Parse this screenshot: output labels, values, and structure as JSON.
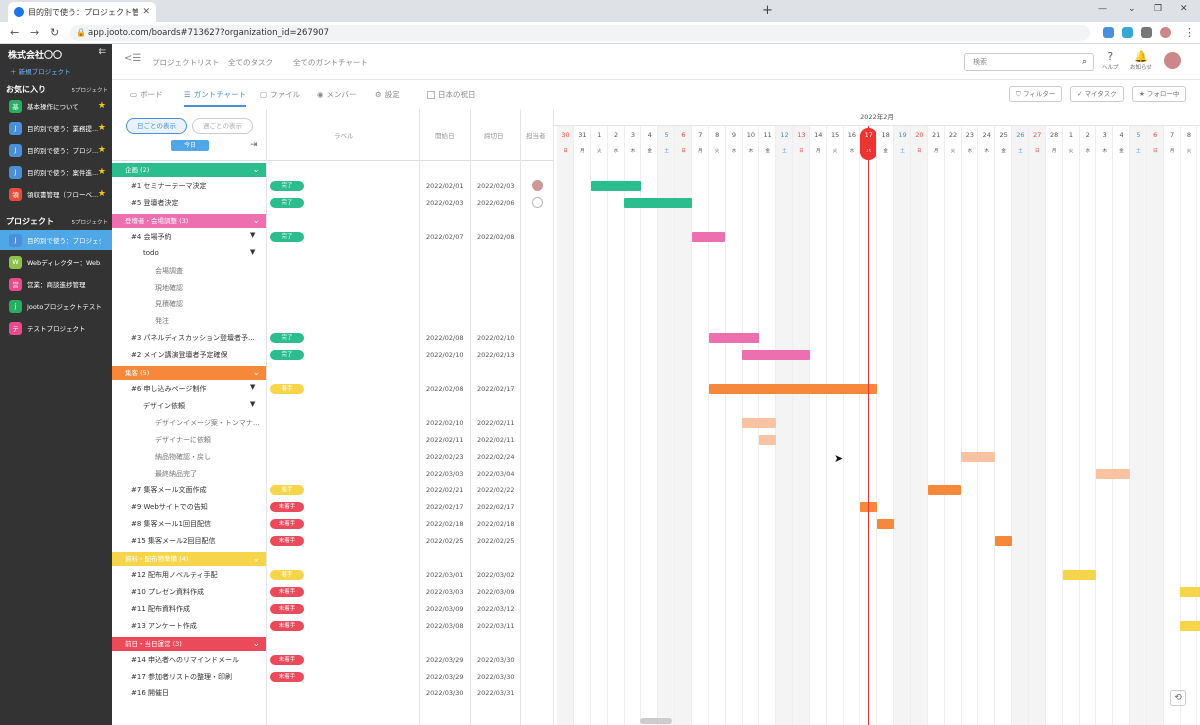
{
  "browser": {
    "tab_title": "目的別で使う：プロジェクト管理 - Jo",
    "url": "app.jooto.com/boards#713627?organization_id=267907"
  },
  "sidebar": {
    "org": "株式会社〇〇",
    "new_project": "新規プロジェクト",
    "fav_title": "お気に入り",
    "fav_count": "5プロジェクト",
    "favorites": [
      {
        "icon": "基",
        "label": "基本操作について",
        "color": "#27ae60"
      },
      {
        "icon": "J",
        "label": "目的別で使う：業務提...",
        "color": "#4a90d9"
      },
      {
        "icon": "J",
        "label": "目的別で使う：プロジ...",
        "color": "#4a90d9"
      },
      {
        "icon": "J",
        "label": "目的別で使う：案件進...",
        "color": "#4a90d9"
      },
      {
        "icon": "領",
        "label": "領収書管理（フローベ...",
        "color": "#e74c3c"
      }
    ],
    "proj_title": "プロジェクト",
    "proj_count": "5プロジェクト",
    "projects": [
      {
        "icon": "J",
        "label": "目的別で使う：プロジェク...",
        "color": "#4a90d9",
        "active": true
      },
      {
        "icon": "W",
        "label": "Webディレクター：Web...",
        "color": "#8bc34a"
      },
      {
        "icon": "営",
        "label": "営業：商談進捗管理",
        "color": "#e84a8a"
      },
      {
        "icon": "j",
        "label": "Jootoプロジェクトテスト",
        "color": "#27ae60"
      },
      {
        "icon": "テ",
        "label": "テストプロジェクト",
        "color": "#e84a8a"
      }
    ]
  },
  "topnav": {
    "project_list": "プロジェクトリスト",
    "all_tasks": "全てのタスク",
    "all_gantt": "全てのガントチャート",
    "search_placeholder": "検索",
    "help": "ヘルプ",
    "notice": "お知らせ"
  },
  "views": {
    "board": "ボード",
    "gantt": "ガントチャート",
    "file": "ファイル",
    "member": "メンバー",
    "settings": "設定",
    "holiday": "日本の祝日",
    "filter": "フィルター",
    "mytask": "マイタスク",
    "follow": "フォロー中"
  },
  "gantt_head": {
    "by_day": "日ごとの表示",
    "by_week": "週ごとの表示",
    "today": "今日",
    "label": "ラベル",
    "start": "開始日",
    "end": "締切日",
    "assignee": "担当者"
  },
  "chart": {
    "month": "2022年2月",
    "days": [
      "30",
      "31",
      "1",
      "2",
      "3",
      "4",
      "5",
      "6",
      "7",
      "8",
      "9",
      "10",
      "11",
      "12",
      "13",
      "14",
      "15",
      "16",
      "17",
      "18",
      "19",
      "20",
      "21",
      "22",
      "23",
      "24",
      "25",
      "26",
      "27",
      "28",
      "1",
      "2",
      "3",
      "4",
      "5",
      "6",
      "7",
      "8"
    ],
    "dows": [
      "日",
      "月",
      "火",
      "水",
      "木",
      "金",
      "土",
      "日",
      "月",
      "火",
      "水",
      "木",
      "金",
      "土",
      "日",
      "月",
      "火",
      "水",
      "木",
      "金",
      "土",
      "日",
      "月",
      "火",
      "水",
      "木",
      "金",
      "土",
      "日",
      "月",
      "火",
      "水",
      "木",
      "金",
      "土",
      "日",
      "月",
      "火"
    ],
    "today_index": 18
  },
  "rows": [
    {
      "type": "group",
      "name": "企画 (2)",
      "color": "#2bbd8e"
    },
    {
      "type": "task",
      "name": "#1 セミナーテーマ決定",
      "indent": 0,
      "label": "完了",
      "lc": "#2bbd8e",
      "start": "2022/02/01",
      "end": "2022/02/03",
      "bar": [
        2,
        3
      ],
      "bc": "#2bbd8e",
      "av": 1
    },
    {
      "type": "task",
      "name": "#5 登壇者決定",
      "indent": 0,
      "label": "完了",
      "lc": "#2bbd8e",
      "start": "2022/02/03",
      "end": "2022/02/06",
      "bar": [
        4,
        4
      ],
      "bc": "#2bbd8e",
      "av": 2
    },
    {
      "type": "group",
      "name": "登壇者・会場調整 (3)",
      "color": "#ec6fb0"
    },
    {
      "type": "task",
      "name": "#4 会場予約",
      "indent": 0,
      "label": "完了",
      "lc": "#2bbd8e",
      "start": "2022/02/07",
      "end": "2022/02/08",
      "bar": [
        8,
        2
      ],
      "bc": "#ec6fb0",
      "tri": 1
    },
    {
      "type": "task",
      "name": "todo",
      "indent": 1,
      "tri": 1
    },
    {
      "type": "task",
      "name": "会場調査",
      "indent": 2
    },
    {
      "type": "task",
      "name": "現地確認",
      "indent": 2
    },
    {
      "type": "task",
      "name": "見積確認",
      "indent": 2
    },
    {
      "type": "task",
      "name": "発注",
      "indent": 2
    },
    {
      "type": "task",
      "name": "#3 パネルディスカッション登壇者予...",
      "indent": 0,
      "label": "完了",
      "lc": "#2bbd8e",
      "start": "2022/02/08",
      "end": "2022/02/10",
      "bar": [
        9,
        3
      ],
      "bc": "#ec6fb0"
    },
    {
      "type": "task",
      "name": "#2 メイン講演登壇者予定確保",
      "indent": 0,
      "label": "完了",
      "lc": "#2bbd8e",
      "start": "2022/02/10",
      "end": "2022/02/13",
      "bar": [
        11,
        4
      ],
      "bc": "#ec6fb0"
    },
    {
      "type": "group",
      "name": "集客 (5)",
      "color": "#f5883a"
    },
    {
      "type": "task",
      "name": "#6 申し込みページ制作",
      "indent": 0,
      "label": "着手",
      "lc": "#f7d54a",
      "start": "2022/02/08",
      "end": "2022/02/17",
      "bar": [
        9,
        10
      ],
      "bc": "#f5883a",
      "tri": 1
    },
    {
      "type": "task",
      "name": "デザイン依頼",
      "indent": 1,
      "tri": 1
    },
    {
      "type": "task",
      "name": "デザインイメージ案・トンマナ...",
      "indent": 2,
      "start": "2022/02/10",
      "end": "2022/02/11",
      "bar": [
        11,
        2
      ],
      "bc": "#f9c2a0"
    },
    {
      "type": "task",
      "name": "デザイナーに依頼",
      "indent": 2,
      "start": "2022/02/11",
      "end": "2022/02/11",
      "bar": [
        12,
        1
      ],
      "bc": "#f9c2a0"
    },
    {
      "type": "task",
      "name": "納品物確認・戻し",
      "indent": 2,
      "start": "2022/02/23",
      "end": "2022/02/24",
      "bar": [
        24,
        2
      ],
      "bc": "#f9c2a0"
    },
    {
      "type": "task",
      "name": "最終納品完了",
      "indent": 2,
      "start": "2022/03/03",
      "end": "2022/03/04",
      "bar": [
        32,
        2
      ],
      "bc": "#f9c2a0"
    },
    {
      "type": "task",
      "name": "#7 集客メール文面作成",
      "indent": 0,
      "label": "着手",
      "lc": "#f7d54a",
      "start": "2022/02/21",
      "end": "2022/02/22",
      "bar": [
        22,
        2
      ],
      "bc": "#f5883a"
    },
    {
      "type": "task",
      "name": "#9 Webサイトでの告知",
      "indent": 0,
      "label": "未着手",
      "lc": "#ea4a5a",
      "start": "2022/02/17",
      "end": "2022/02/17",
      "bar": [
        18,
        1
      ],
      "bc": "#f5883a"
    },
    {
      "type": "task",
      "name": "#8 集客メール1回目配信",
      "indent": 0,
      "label": "未着手",
      "lc": "#ea4a5a",
      "start": "2022/02/18",
      "end": "2022/02/18",
      "bar": [
        19,
        1
      ],
      "bc": "#f5883a"
    },
    {
      "type": "task",
      "name": "#15 集客メール2回目配信",
      "indent": 0,
      "label": "未着手",
      "lc": "#ea4a5a",
      "start": "2022/02/25",
      "end": "2022/02/25",
      "bar": [
        26,
        1
      ],
      "bc": "#f5883a"
    },
    {
      "type": "group",
      "name": "資料・配布物準備 (4)",
      "color": "#f7d54a"
    },
    {
      "type": "task",
      "name": "#12 配布用ノベルティ手配",
      "indent": 0,
      "label": "着手",
      "lc": "#f7d54a",
      "start": "2022/03/01",
      "end": "2022/03/02",
      "bar": [
        30,
        2
      ],
      "bc": "#f7d54a"
    },
    {
      "type": "task",
      "name": "#10 プレゼン資料作成",
      "indent": 0,
      "label": "未着手",
      "lc": "#ea4a5a",
      "start": "2022/03/03",
      "end": "2022/03/09",
      "bar": [
        37,
        3
      ],
      "bc": "#f7d54a"
    },
    {
      "type": "task",
      "name": "#11 配布資料作成",
      "indent": 0,
      "label": "未着手",
      "lc": "#ea4a5a",
      "start": "2022/03/09",
      "end": "2022/03/12",
      "bar": [
        37,
        3
      ],
      "bc": "#f7d54a",
      "hide": 1
    },
    {
      "type": "task",
      "name": "#13 アンケート作成",
      "indent": 0,
      "label": "未着手",
      "lc": "#ea4a5a",
      "start": "2022/03/08",
      "end": "2022/03/11",
      "bar": [
        37,
        3
      ],
      "bc": "#f7d54a"
    },
    {
      "type": "group",
      "name": "前日・当日運営 (3)",
      "color": "#ea4a5a"
    },
    {
      "type": "task",
      "name": "#14 申込者へのリマインドメール",
      "indent": 0,
      "label": "未着手",
      "lc": "#ea4a5a",
      "start": "2022/03/29",
      "end": "2022/03/30"
    },
    {
      "type": "task",
      "name": "#17 参加者リストの整理・印刷",
      "indent": 0,
      "label": "未着手",
      "lc": "#ea4a5a",
      "start": "2022/03/29",
      "end": "2022/03/30"
    },
    {
      "type": "task",
      "name": "#16 開催日",
      "indent": 0,
      "start": "2022/03/30",
      "end": "2022/03/31"
    }
  ]
}
